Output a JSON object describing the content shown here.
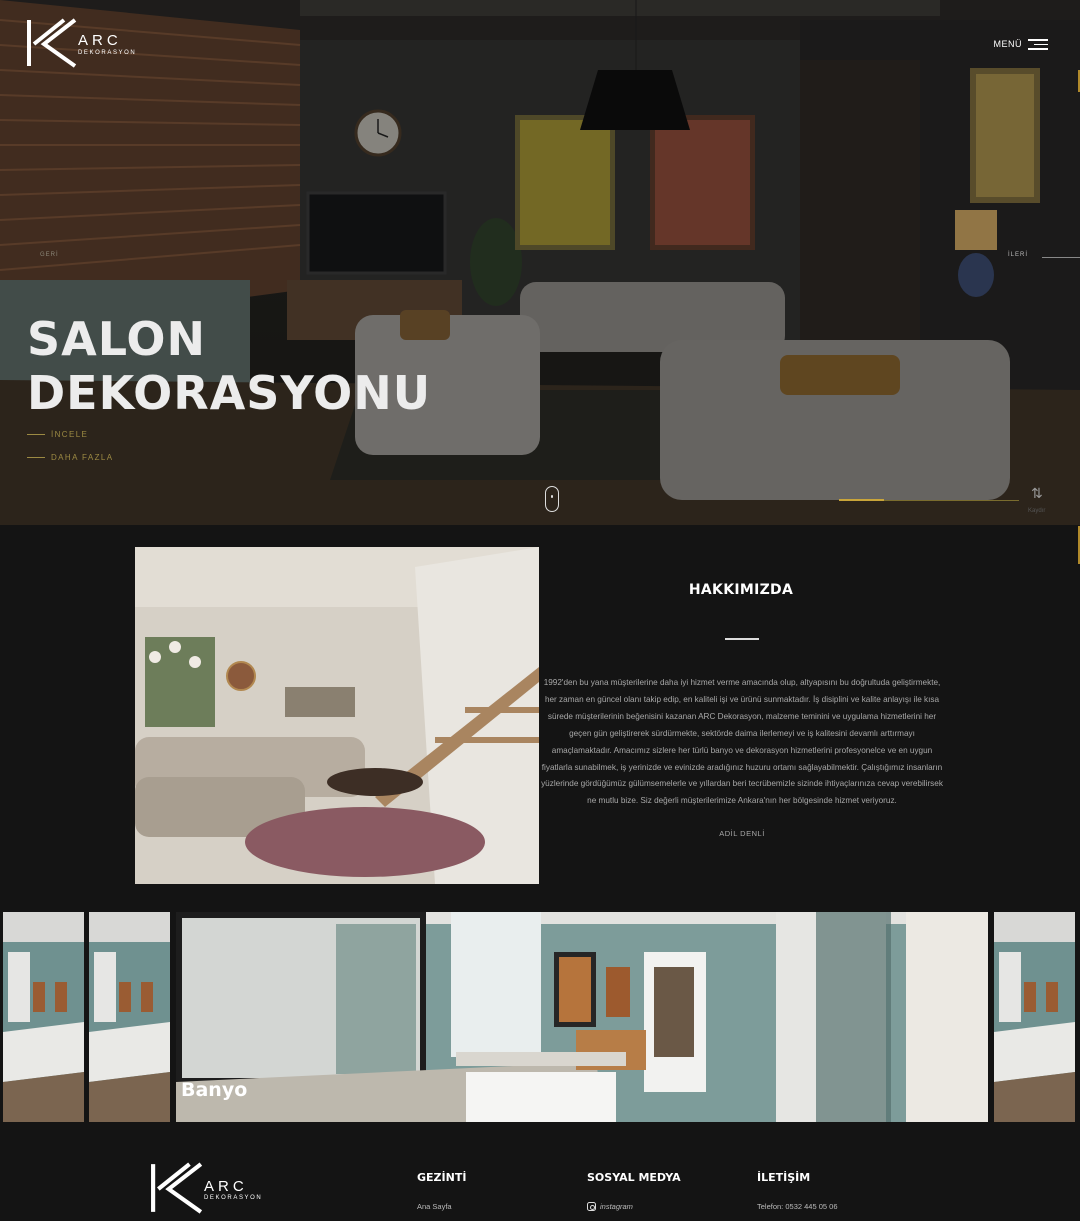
{
  "brand": {
    "name": "ARC",
    "subtitle": "DEKORASYON"
  },
  "header": {
    "menu_label": "MENÜ"
  },
  "hero": {
    "prev_label": "GERİ",
    "next_label": "İLERİ",
    "title_line1": "SALON",
    "title_line2": "DEKORASYONU",
    "cta_primary": "İNCELE",
    "cta_secondary": "DAHA FAZLA",
    "slide_progress": 0.25,
    "counter_label": "Kaydır"
  },
  "about": {
    "title": "HAKKIMIZDA",
    "body": "1992'den bu yana müşterilerine daha iyi hizmet verme amacında olup, altyapısını bu doğrultuda geliştirmekte, her zaman en güncel olanı takip edip, en kaliteli işi ve ürünü sunmaktadır. İş disiplini ve kalite anlayışı ile kısa sürede müşterilerinin beğenisini kazanan ARC Dekorasyon, malzeme teminini ve uygulama hizmetlerini her geçen gün geliştirerek sürdürmekte, sektörde daima ilerlemeyi ve iş kalitesini devamlı arttırmayı amaçlamaktadır. Amacımız sizlere her türlü banyo ve dekorasyon hizmetlerini profesyonelce ve en uygun fiyatlarla sunabilmek, iş yerinizde ve evinizde aradığınız huzuru ortamı sağlayabilmektir. Çalıştığımız insanların yüzlerinde gördüğümüz gülümsemelerle ve yıllardan beri tecrübemizle sizinde ihtiyaçlarınıza cevap verebilirsek ne mutlu bize. Siz değerli müşterilerimize Ankara'nın her bölgesinde hizmet veriyoruz.",
    "signature": "ADİL DENLİ"
  },
  "gallery": {
    "active_title": "Banyo"
  },
  "footer": {
    "col_nav_title": "GEZİNTİ",
    "col_nav_item": "Ana Sayfa",
    "col_social_title": "SOSYAL MEDYA",
    "col_social_item": "instagram",
    "col_contact_title": "İLETİŞİM",
    "col_contact_item": "Telefon: 0532 445 05 06"
  },
  "colors": {
    "accent": "#c9a53a",
    "background": "#141414"
  }
}
